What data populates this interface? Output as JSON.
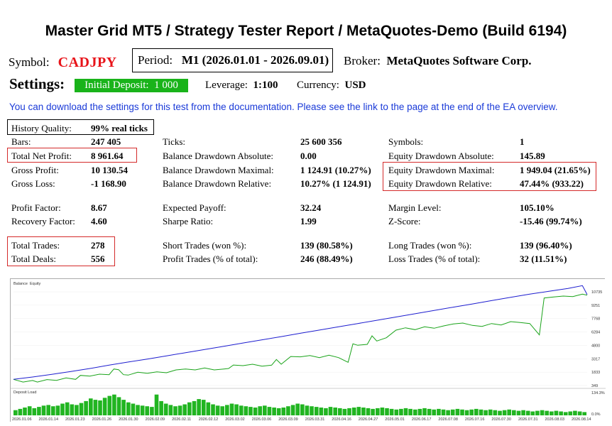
{
  "title": "Master Grid MT5  /  Strategy Tester Report  /  MetaQuotes-Demo (Build 6194)",
  "symbol": {
    "label": "Symbol:",
    "value": "CADJPY"
  },
  "period": {
    "label": "Period:",
    "value": "M1 (2026.01.01 - 2026.09.01)"
  },
  "broker": {
    "label": "Broker:",
    "value": "MetaQuotes Software Corp."
  },
  "settings": {
    "label": "Settings:",
    "deposit_label": "Initial Deposit:",
    "deposit_value": "1 000",
    "leverage_label": "Leverage:",
    "leverage_value": "1:100",
    "currency_label": "Currency:",
    "currency_value": "USD"
  },
  "note": "You can download the settings for this test from the documentation. Please see the link to the page at the end of the EA overview.",
  "stats": {
    "history_quality": {
      "label": "History Quality:",
      "value": "99% real ticks"
    },
    "bars": {
      "label": "Bars:",
      "value": "247 405"
    },
    "total_net_profit": {
      "label": "Total Net Profit:",
      "value": "8 961.64"
    },
    "gross_profit": {
      "label": "Gross Profit:",
      "value": "10 130.54"
    },
    "gross_loss": {
      "label": "Gross Loss:",
      "value": "-1 168.90"
    },
    "ticks": {
      "label": "Ticks:",
      "value": "25 600 356"
    },
    "bal_dd_abs": {
      "label": "Balance Drawdown Absolute:",
      "value": "0.00"
    },
    "bal_dd_max": {
      "label": "Balance Drawdown Maximal:",
      "value": "1 124.91 (10.27%)"
    },
    "bal_dd_rel": {
      "label": "Balance Drawdown Relative:",
      "value": "10.27% (1 124.91)"
    },
    "symbols": {
      "label": "Symbols:",
      "value": "1"
    },
    "eq_dd_abs": {
      "label": "Equity Drawdown Absolute:",
      "value": "145.89"
    },
    "eq_dd_max": {
      "label": "Equity Drawdown Maximal:",
      "value": "1 949.04 (21.65%)"
    },
    "eq_dd_rel": {
      "label": "Equity Drawdown Relative:",
      "value": "47.44% (933.22)"
    },
    "profit_factor": {
      "label": "Profit Factor:",
      "value": "8.67"
    },
    "recovery_factor": {
      "label": "Recovery Factor:",
      "value": "4.60"
    },
    "expected_payoff": {
      "label": "Expected Payoff:",
      "value": "32.24"
    },
    "sharpe": {
      "label": "Sharpe Ratio:",
      "value": "1.99"
    },
    "margin_level": {
      "label": "Margin Level:",
      "value": "105.10%"
    },
    "z_score": {
      "label": "Z-Score:",
      "value": "-15.46 (99.74%)"
    },
    "total_trades": {
      "label": "Total Trades:",
      "value": "278"
    },
    "total_deals": {
      "label": "Total Deals:",
      "value": "556"
    },
    "short_trades": {
      "label": "Short Trades (won %):",
      "value": "139 (80.58%)"
    },
    "profit_trades": {
      "label": "Profit Trades (% of total):",
      "value": "246 (88.49%)"
    },
    "long_trades": {
      "label": "Long Trades (won %):",
      "value": "139 (96.40%)"
    },
    "loss_trades": {
      "label": "Loss Trades (% of total):",
      "value": "32 (11.51%)"
    }
  },
  "colors": {
    "highlight_box": "#d42a2a",
    "deposit_bg": "#19b31a",
    "balance_line": "#1d1dcf",
    "equity_line": "#19a319",
    "load_bars": "#21b521"
  },
  "chart_data": {
    "type": "line",
    "legend": [
      "Balance",
      "Equity"
    ],
    "x_ticks": [
      "2026.01.06",
      "2026.01.14",
      "2026.01.23",
      "2026.01.26",
      "2026.01.30",
      "2026.02.09",
      "2026.02.11",
      "2026.02.12",
      "2026.03.02",
      "2026.03.06",
      "2026.03.09",
      "2026.03.31",
      "2026.04.16",
      "2026.04.27",
      "2026.05.01",
      "2026.06.17",
      "2026.07.08",
      "2026.07.16",
      "2026.07.30",
      "2026.07.31",
      "2026.08.03",
      "2026.08.14"
    ],
    "y_ticks": [
      "10735",
      "9251",
      "7768",
      "6284",
      "4800",
      "3317",
      "1833",
      "349"
    ],
    "ylim": [
      349,
      11150
    ],
    "balance": [
      [
        0,
        1000
      ],
      [
        4,
        1250
      ],
      [
        8,
        1530
      ],
      [
        12,
        1830
      ],
      [
        16,
        2150
      ],
      [
        20,
        2500
      ],
      [
        24,
        2830
      ],
      [
        28,
        3150
      ],
      [
        32,
        3480
      ],
      [
        36,
        3820
      ],
      [
        40,
        4150
      ],
      [
        44,
        4500
      ],
      [
        48,
        4840
      ],
      [
        52,
        5180
      ],
      [
        56,
        5520
      ],
      [
        60,
        5870
      ],
      [
        64,
        6210
      ],
      [
        68,
        6550
      ],
      [
        72,
        6900
      ],
      [
        76,
        7240
      ],
      [
        80,
        7590
      ],
      [
        84,
        7930
      ],
      [
        88,
        8280
      ],
      [
        92,
        8630
      ],
      [
        96,
        8970
      ],
      [
        100,
        9320
      ],
      [
        104,
        9670
      ],
      [
        108,
        10000
      ],
      [
        112,
        10300
      ],
      [
        116,
        10600
      ],
      [
        119,
        10900
      ],
      [
        120,
        9960
      ]
    ],
    "equity": [
      [
        0,
        1000
      ],
      [
        2,
        720
      ],
      [
        4,
        880
      ],
      [
        5,
        720
      ],
      [
        7,
        980
      ],
      [
        9,
        900
      ],
      [
        11,
        1150
      ],
      [
        13,
        1000
      ],
      [
        14,
        1420
      ],
      [
        16,
        1350
      ],
      [
        18,
        1550
      ],
      [
        20,
        1500
      ],
      [
        21,
        2100
      ],
      [
        22,
        2020
      ],
      [
        23,
        1500
      ],
      [
        24,
        1450
      ],
      [
        26,
        1750
      ],
      [
        28,
        1650
      ],
      [
        30,
        1800
      ],
      [
        32,
        1700
      ],
      [
        34,
        2000
      ],
      [
        36,
        2100
      ],
      [
        38,
        2000
      ],
      [
        40,
        2200
      ],
      [
        42,
        2000
      ],
      [
        44,
        2100
      ],
      [
        45,
        2150
      ],
      [
        46,
        2520
      ],
      [
        48,
        2450
      ],
      [
        50,
        2600
      ],
      [
        52,
        2400
      ],
      [
        54,
        2500
      ],
      [
        55,
        3100
      ],
      [
        56,
        2600
      ],
      [
        58,
        3420
      ],
      [
        60,
        3380
      ],
      [
        62,
        3520
      ],
      [
        64,
        3300
      ],
      [
        66,
        3550
      ],
      [
        68,
        3300
      ],
      [
        70,
        2800
      ],
      [
        71,
        4750
      ],
      [
        72,
        4600
      ],
      [
        74,
        4700
      ],
      [
        75,
        5600
      ],
      [
        76,
        5050
      ],
      [
        78,
        5400
      ],
      [
        80,
        6200
      ],
      [
        82,
        6450
      ],
      [
        84,
        6250
      ],
      [
        86,
        6550
      ],
      [
        88,
        6400
      ],
      [
        90,
        6650
      ],
      [
        92,
        6850
      ],
      [
        94,
        6950
      ],
      [
        96,
        6700
      ],
      [
        98,
        6600
      ],
      [
        100,
        6900
      ],
      [
        102,
        6750
      ],
      [
        104,
        7100
      ],
      [
        106,
        7000
      ],
      [
        108,
        6900
      ],
      [
        110,
        5700
      ],
      [
        111,
        9600
      ],
      [
        113,
        9700
      ],
      [
        115,
        9800
      ],
      [
        117,
        9750
      ],
      [
        119,
        10000
      ],
      [
        120,
        9900
      ]
    ],
    "load_label": "Deposit Load",
    "load_ticks": [
      "134.3%",
      "0.0%"
    ],
    "load": [
      8,
      10,
      12,
      14,
      11,
      13,
      15,
      16,
      14,
      15,
      18,
      20,
      17,
      16,
      19,
      22,
      26,
      24,
      23,
      27,
      30,
      32,
      28,
      24,
      20,
      18,
      16,
      15,
      14,
      13,
      32,
      22,
      18,
      16,
      14,
      15,
      17,
      20,
      22,
      25,
      24,
      20,
      17,
      15,
      14,
      16,
      18,
      17,
      15,
      14,
      13,
      12,
      14,
      15,
      13,
      12,
      11,
      12,
      14,
      16,
      18,
      17,
      15,
      14,
      13,
      12,
      11,
      13,
      12,
      11,
      10,
      11,
      12,
      13,
      12,
      11,
      10,
      11,
      12,
      11,
      10,
      9,
      10,
      11,
      10,
      9,
      10,
      11,
      10,
      9,
      10,
      9,
      8,
      9,
      10,
      9,
      8,
      9,
      10,
      9,
      8,
      9,
      8,
      7,
      8,
      9,
      8,
      7,
      8,
      7,
      6,
      7,
      8,
      7,
      6,
      7,
      6,
      5,
      6,
      7,
      6,
      5
    ]
  }
}
